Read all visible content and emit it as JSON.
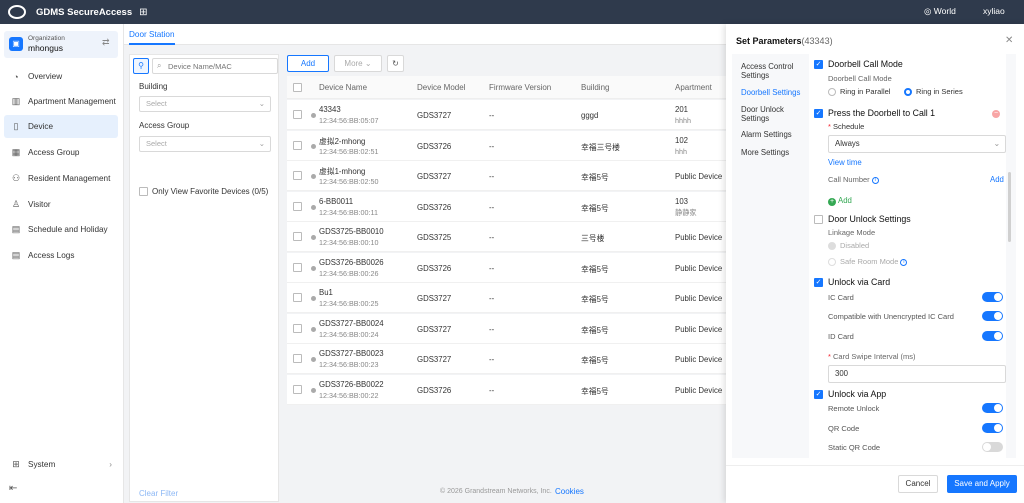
{
  "topbar": {
    "app_title": "GDMS SecureAccess",
    "region": "World",
    "user": "xyliao",
    "icons": [
      "logo-icon",
      "app-grid-icon",
      "globe-icon"
    ]
  },
  "sidebar": {
    "org_label": "Organization",
    "org_name": "mhongus",
    "items": [
      {
        "label": "Overview",
        "icon": "overview-icon"
      },
      {
        "label": "Apartment Management",
        "icon": "apartment-icon"
      },
      {
        "label": "Device",
        "icon": "device-icon",
        "active": true
      },
      {
        "label": "Access Group",
        "icon": "access-group-icon"
      },
      {
        "label": "Resident Management",
        "icon": "resident-icon"
      },
      {
        "label": "Visitor",
        "icon": "visitor-icon"
      },
      {
        "label": "Schedule and Holiday",
        "icon": "calendar-icon"
      },
      {
        "label": "Access Logs",
        "icon": "logs-icon"
      }
    ],
    "system_label": "System"
  },
  "main": {
    "tab": "Door Station",
    "search_placeholder": "Device Name/MAC",
    "filter": {
      "building_label": "Building",
      "building_placeholder": "Select",
      "access_group_label": "Access Group",
      "access_group_placeholder": "Select",
      "favorite_label": "Only View Favorite Devices (0/5)",
      "clear_label": "Clear Filter"
    },
    "toolbar": {
      "add_label": "Add",
      "more_label": "More"
    },
    "table": {
      "columns": [
        "Device Name",
        "Device Model",
        "Firmware Version",
        "Building",
        "Apartment"
      ],
      "rows": [
        {
          "name": "43343",
          "mac": "12:34:56:BB:05:07",
          "model": "GDS3727",
          "firmware": "--",
          "building": "gggd",
          "apartment": "201",
          "apartment_sub": "hhhh"
        },
        {
          "name": "虚拟2-mhong",
          "mac": "12:34:56:BB:02:51",
          "model": "GDS3726",
          "firmware": "--",
          "building": "幸福三号楼",
          "apartment": "102",
          "apartment_sub": "hhh"
        },
        {
          "name": "虚拟1-mhong",
          "mac": "12:34:56:BB:02:50",
          "model": "GDS3727",
          "firmware": "--",
          "building": "幸福5号",
          "apartment": "Public Device",
          "apartment_sub": ""
        },
        {
          "name": "6-BB0011",
          "mac": "12:34:56:BB:00:11",
          "model": "GDS3726",
          "firmware": "--",
          "building": "幸福5号",
          "apartment": "103",
          "apartment_sub": "静静家"
        },
        {
          "name": "GDS3725-BB0010",
          "mac": "12:34:56:BB:00:10",
          "model": "GDS3725",
          "firmware": "--",
          "building": "三号楼",
          "apartment": "Public Device",
          "apartment_sub": ""
        },
        {
          "name": "GDS3726-BB0026",
          "mac": "12:34:56:BB:00:26",
          "model": "GDS3726",
          "firmware": "--",
          "building": "幸福5号",
          "apartment": "Public Device",
          "apartment_sub": ""
        },
        {
          "name": "Bu1",
          "mac": "12:34:56:BB:00:25",
          "model": "GDS3727",
          "firmware": "--",
          "building": "幸福5号",
          "apartment": "Public Device",
          "apartment_sub": ""
        },
        {
          "name": "GDS3727-BB0024",
          "mac": "12:34:56:BB:00:24",
          "model": "GDS3727",
          "firmware": "--",
          "building": "幸福5号",
          "apartment": "Public Device",
          "apartment_sub": ""
        },
        {
          "name": "GDS3727-BB0023",
          "mac": "12:34:56:BB:00:23",
          "model": "GDS3727",
          "firmware": "--",
          "building": "幸福5号",
          "apartment": "Public Device",
          "apartment_sub": ""
        },
        {
          "name": "GDS3726-BB0022",
          "mac": "12:34:56:BB:00:22",
          "model": "GDS3726",
          "firmware": "--",
          "building": "幸福5号",
          "apartment": "Public Device",
          "apartment_sub": ""
        }
      ]
    },
    "footer": {
      "copyright": "© 2026 Grandstream Networks, Inc.",
      "cookies": "Cookies"
    }
  },
  "drawer": {
    "title": "Set Parameters",
    "device_id": "(43343)",
    "nav": [
      "Access Control Settings",
      "Doorbell Settings",
      "Door Unlock Settings",
      "Alarm Settings",
      "More Settings"
    ],
    "active_nav": "Doorbell Settings",
    "doorbell_call_mode": {
      "title": "Doorbell Call Mode",
      "label": "Doorbell Call Mode",
      "options": [
        "Ring in Parallel",
        "Ring in Series"
      ],
      "selected": "Ring in Series"
    },
    "press_doorbell": {
      "title": "Press the Doorbell to Call 1",
      "schedule_label": "Schedule",
      "schedule_value": "Always",
      "view_time": "View time",
      "call_number_label": "Call Number",
      "add_label": "Add",
      "add_link": "Add"
    },
    "door_unlock": {
      "title": "Door Unlock Settings",
      "checked": false,
      "linkage_label": "Linkage Mode",
      "options": [
        "Disabled",
        "Safe Room Mode"
      ]
    },
    "unlock_card": {
      "title": "Unlock via Card",
      "toggles": [
        {
          "label": "IC Card",
          "on": true
        },
        {
          "label": "Compatible with Unencrypted IC Card",
          "on": true
        },
        {
          "label": "ID Card",
          "on": true
        }
      ],
      "interval_label": "Card Swipe Interval (ms)",
      "interval_value": "300"
    },
    "unlock_app": {
      "title": "Unlock via App",
      "toggles": [
        {
          "label": "Remote Unlock",
          "on": true
        },
        {
          "label": "QR Code",
          "on": true
        },
        {
          "label": "Static QR Code",
          "on": false
        }
      ]
    },
    "cancel_label": "Cancel",
    "save_label": "Save and Apply"
  },
  "colors": {
    "accent": "#1677ff",
    "topbar": "#2f3a4c",
    "toggle_off": "#d9d9d9"
  }
}
